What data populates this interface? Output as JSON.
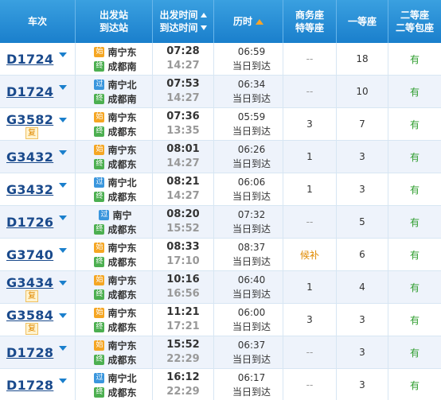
{
  "header": {
    "train": "车次",
    "dep_station": "出发站",
    "arr_station": "到达站",
    "dep_time": "出发时间",
    "arr_time": "到达时间",
    "duration": "历时",
    "business": "商务座",
    "premium": "特等座",
    "first": "一等座",
    "second": "二等座",
    "second_box": "二等包座"
  },
  "station_badges": {
    "start": "始",
    "pass": "过",
    "end": "终"
  },
  "rows": [
    {
      "train": "D1724",
      "badge": "",
      "from_type": "start",
      "from": "南宁东",
      "to_type": "end",
      "to": "成都南",
      "dep": "07:28",
      "arr": "14:27",
      "dur": "06:59",
      "note": "当日到达",
      "biz": "--",
      "first": "18",
      "second": "有"
    },
    {
      "train": "D1724",
      "badge": "",
      "from_type": "pass",
      "from": "南宁北",
      "to_type": "end",
      "to": "成都南",
      "dep": "07:53",
      "arr": "14:27",
      "dur": "06:34",
      "note": "当日到达",
      "biz": "--",
      "first": "10",
      "second": "有"
    },
    {
      "train": "G3582",
      "badge": "复",
      "from_type": "start",
      "from": "南宁东",
      "to_type": "end",
      "to": "成都东",
      "dep": "07:36",
      "arr": "13:35",
      "dur": "05:59",
      "note": "当日到达",
      "biz": "3",
      "first": "7",
      "second": "有"
    },
    {
      "train": "G3432",
      "badge": "",
      "from_type": "start",
      "from": "南宁东",
      "to_type": "end",
      "to": "成都东",
      "dep": "08:01",
      "arr": "14:27",
      "dur": "06:26",
      "note": "当日到达",
      "biz": "1",
      "first": "3",
      "second": "有"
    },
    {
      "train": "G3432",
      "badge": "",
      "from_type": "pass",
      "from": "南宁北",
      "to_type": "end",
      "to": "成都东",
      "dep": "08:21",
      "arr": "14:27",
      "dur": "06:06",
      "note": "当日到达",
      "biz": "1",
      "first": "3",
      "second": "有"
    },
    {
      "train": "D1726",
      "badge": "",
      "from_type": "pass",
      "from": "南宁",
      "to_type": "end",
      "to": "成都东",
      "dep": "08:20",
      "arr": "15:52",
      "dur": "07:32",
      "note": "当日到达",
      "biz": "--",
      "first": "5",
      "second": "有"
    },
    {
      "train": "G3740",
      "badge": "",
      "from_type": "start",
      "from": "南宁东",
      "to_type": "end",
      "to": "成都东",
      "dep": "08:33",
      "arr": "17:10",
      "dur": "08:37",
      "note": "当日到达",
      "biz": "候补",
      "first": "6",
      "second": "有"
    },
    {
      "train": "G3434",
      "badge": "复",
      "from_type": "start",
      "from": "南宁东",
      "to_type": "end",
      "to": "成都东",
      "dep": "10:16",
      "arr": "16:56",
      "dur": "06:40",
      "note": "当日到达",
      "biz": "1",
      "first": "4",
      "second": "有"
    },
    {
      "train": "G3584",
      "badge": "复",
      "from_type": "start",
      "from": "南宁东",
      "to_type": "end",
      "to": "成都东",
      "dep": "11:21",
      "arr": "17:21",
      "dur": "06:00",
      "note": "当日到达",
      "biz": "3",
      "first": "3",
      "second": "有"
    },
    {
      "train": "D1728",
      "badge": "",
      "from_type": "start",
      "from": "南宁东",
      "to_type": "end",
      "to": "成都东",
      "dep": "15:52",
      "arr": "22:29",
      "dur": "06:37",
      "note": "当日到达",
      "biz": "--",
      "first": "3",
      "second": "有"
    },
    {
      "train": "D1728",
      "badge": "",
      "from_type": "pass",
      "from": "南宁北",
      "to_type": "end",
      "to": "成都东",
      "dep": "16:12",
      "arr": "22:29",
      "dur": "06:17",
      "note": "当日到达",
      "biz": "--",
      "first": "3",
      "second": "有"
    }
  ]
}
